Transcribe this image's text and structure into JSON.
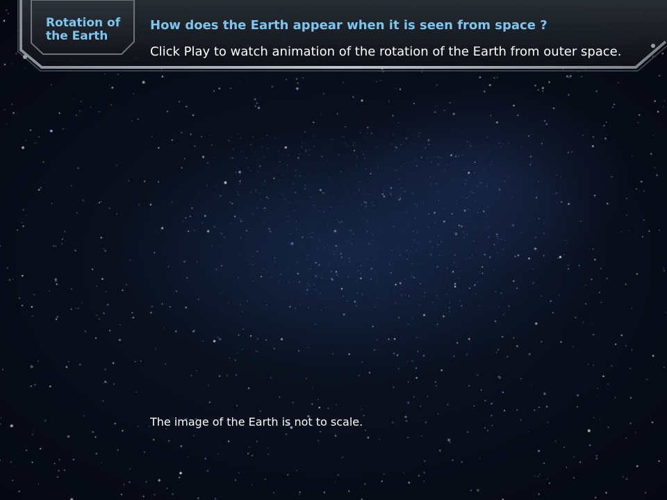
{
  "header": {
    "topic": "Rotation of the Earth",
    "question": "How does the Earth appear when it is seen from space ?",
    "instruction": "Click Play to watch animation of the rotation of the Earth from outer space."
  },
  "main": {
    "note": "The image of the Earth is not to scale."
  },
  "colors": {
    "accent": "#7cc6f0",
    "text": "#ffffff",
    "frame": "#5a5f66",
    "background": "#070b16"
  }
}
